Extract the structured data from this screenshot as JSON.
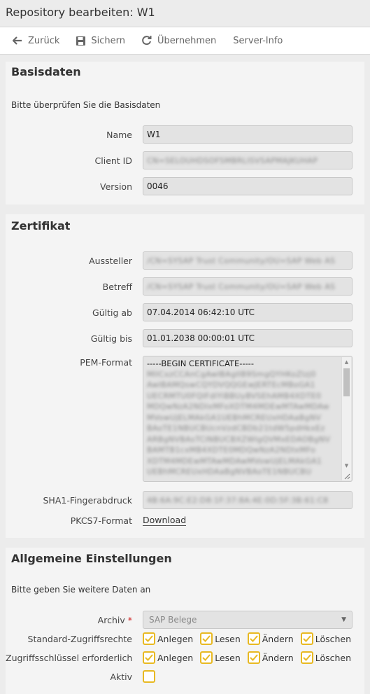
{
  "window": {
    "title": "Repository bearbeiten: W1"
  },
  "toolbar": {
    "back_label": "Zurück",
    "save_label": "Sichern",
    "apply_label": "Übernehmen",
    "server_info_label": "Server-Info"
  },
  "basisdaten": {
    "title": "Basisdaten",
    "hint": "Bitte überprüfen Sie die Basisdaten",
    "name_label": "Name",
    "name_value": "W1",
    "client_id_label": "Client ID",
    "client_id_value": "CN=SELOUHDSOFSMBRLISVSAPMAJKUHAP",
    "version_label": "Version",
    "version_value": "0046"
  },
  "zertifikat": {
    "title": "Zertifikat",
    "issuer_label": "Aussteller",
    "issuer_value": "/CN=SYSAP Trust Community/OU=SAP Web AS",
    "subject_label": "Betreff",
    "subject_value": "/CN=SYSAP Trust Community/OU=SAP Web AS",
    "valid_from_label": "Gültig ab",
    "valid_from_value": "07.04.2014 06:42:10 UTC",
    "valid_to_label": "Gültig bis",
    "valid_to_value": "01.01.2038 00:00:01 UTC",
    "pem_label": "PEM-Format",
    "pem_lines": [
      "-----BEGIN CERTIFICATE-----",
      "MIICxzCCAnCgAwIBAgIIB9SmgQYHKoZIzj0",
      "AwIBAMQswCQYDVQQGEwJERTEcMBoGA1",
      "UECRMTU0FQIFdlYiBBUyBVSEhAMB4XDTE0",
      "MDQwNzA2NDIxMFoXDTM4MDEwMTAwMDAw",
      "MVowUjELMAkGA1UEBhMCREUxHDAaBgNV",
      "BAoTE1NBUCBUcnVzdCBDb21tdW5pdHkxEz",
      "ARBgNVBAsTClNBUCBXZWIgQVMxEDAOBgNV",
      "BAMTB1cxMB4XDTE0MDQwNzA2NDIxMFo",
      "XDTM4MDEwMTAwMDAwMVowUjELMAkGA1",
      "UEBhMCREUxHDAaBgNVBAoTE1NBUCBU"
    ],
    "sha1_label": "SHA1-Fingerabdruck",
    "sha1_value": "4B:6A:9C:E2:D8:1F:37:8A:4E:0D:5F:3B:61:C8",
    "pkcs7_label": "PKCS7-Format",
    "pkcs7_link": "Download"
  },
  "allgemein": {
    "title": "Allgemeine Einstellungen",
    "hint": "Bitte geben Sie weitere Daten an",
    "archive_label": "Archiv",
    "archive_required": "*",
    "archive_value": "SAP Belege",
    "std_rights_label": "Standard-Zugriffsrechte",
    "key_required_label": "Zugriffsschlüssel erforderlich",
    "active_label": "Aktiv",
    "perm_create": "Anlegen",
    "perm_read": "Lesen",
    "perm_change": "Ändern",
    "perm_delete": "Löschen"
  },
  "colors": {
    "accent": "#e8b922",
    "required": "#d02020"
  }
}
